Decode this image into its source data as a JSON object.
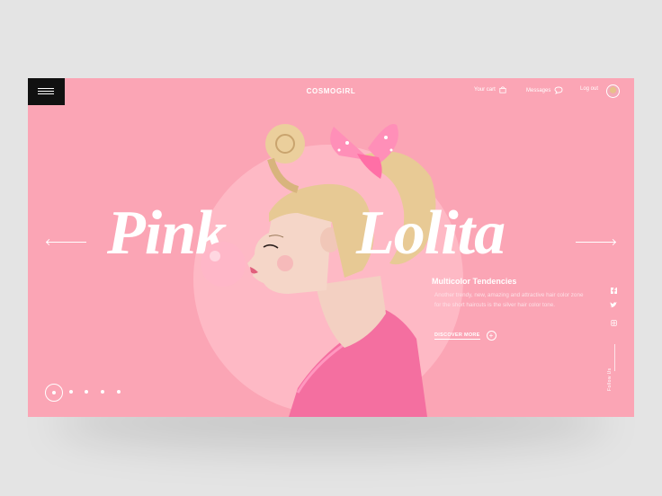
{
  "header": {
    "brand": "COSMOGIRL",
    "nav": [
      {
        "label": "Your cart",
        "icon": "shopping-bag-icon"
      },
      {
        "label": "Messages",
        "icon": "chat-bubble-icon"
      },
      {
        "label": "Log out",
        "icon": "avatar"
      }
    ]
  },
  "hero": {
    "title_left": "Pink",
    "title_right": "Lolita",
    "subheading": "Multicolor Tendencies",
    "description": "Another trendy, new, amazing and attractive hair color zone for the short haircuts is the silver hair color tone.",
    "cta": "DISCOVER MORE"
  },
  "social": {
    "icons": [
      "facebook-icon",
      "twitter-icon",
      "instagram-icon"
    ],
    "follow_label": "Follow Us"
  },
  "pagination": {
    "count": 5,
    "active": 0
  },
  "colors": {
    "background": "#fba5b5",
    "circle": "#ffc0cb",
    "menu": "#111111"
  }
}
